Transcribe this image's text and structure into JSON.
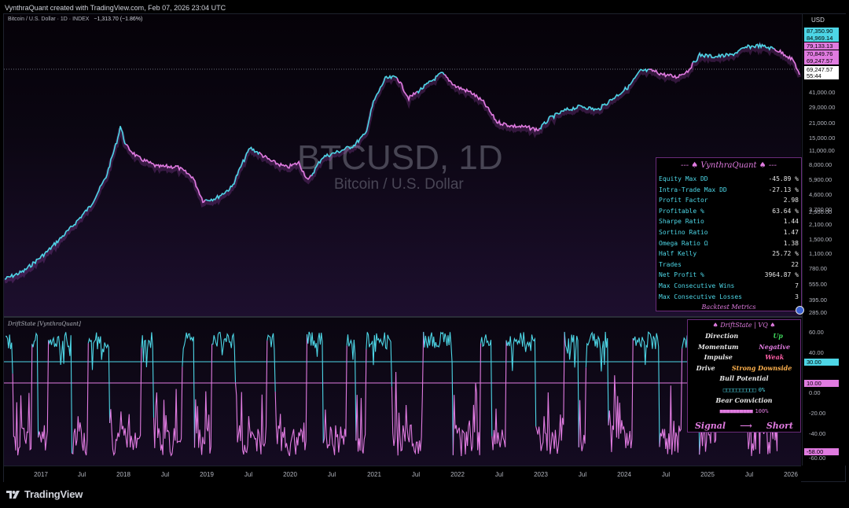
{
  "header": {
    "attribution": "VynthraQuant created with TradingView.com, Feb 07, 2026 23:04 UTC",
    "symbol_line": "Bitcoin / U.S. Dollar · 1D · INDEX",
    "change": "−1,313.70 (−1.86%)"
  },
  "watermark": {
    "title": "BTCUSD, 1D",
    "subtitle": "Bitcoin / U.S. Dollar"
  },
  "price_axis": {
    "currency": "USD",
    "labels": [
      "41,000.00",
      "29,000.00",
      "21,000.00",
      "15,000.00",
      "11,000.00",
      "8,000.00",
      "5,900.00",
      "4,600.00",
      "3,700.00",
      "2,900.00",
      "2,100.00",
      "1,500.00",
      "1,100.00",
      "780.00",
      "555.00",
      "395.00",
      "285.00"
    ],
    "tags": [
      {
        "text": "87,350.90",
        "color": "#4dd6e6"
      },
      {
        "text": "84,969.14",
        "color": "#4dd6e6"
      },
      {
        "text": "79,133.13",
        "color": "#e07be0"
      },
      {
        "text": "70,849.76",
        "color": "#e07be0"
      },
      {
        "text": "69,247.57",
        "color": "#e07be0"
      },
      {
        "text": "69,247.57",
        "color": "#ffffff"
      },
      {
        "text": "55:44",
        "color": "#ffffff"
      }
    ]
  },
  "indicator_axis": {
    "labels": [
      "60.00",
      "40.00",
      "0.00",
      "-20.00",
      "-40.00",
      "-60.00"
    ],
    "tags": [
      {
        "text": "30.00",
        "color": "#4dd6e6"
      },
      {
        "text": "10.00",
        "color": "#e07be0"
      },
      {
        "text": "-58.00",
        "color": "#e07be0"
      }
    ]
  },
  "time_axis": [
    "2017",
    "Jul",
    "2018",
    "Jul",
    "2019",
    "Jul",
    "2020",
    "Jul",
    "2021",
    "Jul",
    "2022",
    "Jul",
    "2023",
    "Jul",
    "2024",
    "Jul",
    "2025",
    "Jul",
    "2026"
  ],
  "indicator": {
    "title": "DriftState [VynthraQuant]"
  },
  "backtest": {
    "title": "--- ♠ VynthraQuant ♠ ---",
    "rows": [
      {
        "label": "Equity Max DD",
        "value": "-45.89 %"
      },
      {
        "label": "Intra-Trade Max DD",
        "value": "-27.13 %"
      },
      {
        "label": "Profit Factor",
        "value": "2.98"
      },
      {
        "label": "Profitable %",
        "value": "63.64 %"
      },
      {
        "label": "Sharpe Ratio",
        "value": "1.44"
      },
      {
        "label": "Sortino Ratio",
        "value": "1.47"
      },
      {
        "label": "Omega Ratio Ω",
        "value": "1.38"
      },
      {
        "label": "Half Kelly",
        "value": "25.72 %"
      },
      {
        "label": "Trades",
        "value": "22"
      },
      {
        "label": "Net Profit %",
        "value": "3964.87 %"
      },
      {
        "label": "Max Consecutive Wins",
        "value": "7"
      },
      {
        "label": "Max Consecutive Losses",
        "value": "3"
      }
    ],
    "footer": "Backtest Metrics"
  },
  "driftstate": {
    "title": "♠ DriftState | VQ ♠",
    "direction_label": "Direction",
    "direction_value": "Up",
    "momentum_label": "Momentum",
    "momentum_value": "Negative",
    "impulse_label": "Impulse",
    "impulse_value": "Weak",
    "drive_label": "Drive",
    "drive_value": "Strong Downside",
    "bull_label": "Bull Potential",
    "bull_bar": "□□□□□□□□□□",
    "bull_value": "0%",
    "bear_label": "Bear Conviction",
    "bear_bar": "■■■■■■■■■■",
    "bear_value": "100%",
    "signal_label": "Signal",
    "signal_arrow": "⟶",
    "signal_value": "Short"
  },
  "colors": {
    "cyan": "#4dd6e6",
    "magenta": "#e07be0",
    "green": "#3fd35a",
    "pink": "#ff5fa8",
    "orange": "#ffb14d"
  },
  "footer": {
    "brand": "TradingView"
  }
}
